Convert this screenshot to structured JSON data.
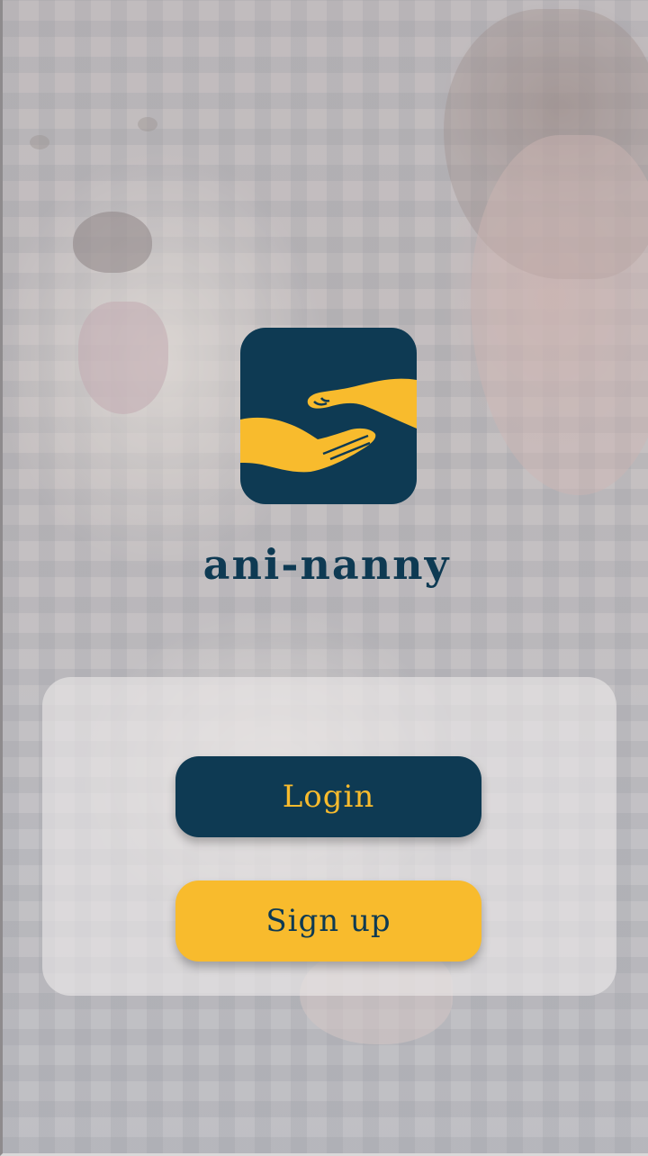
{
  "app": {
    "name": "ani-nanny",
    "logo_icon": "hand-and-paw-icon"
  },
  "colors": {
    "brand_navy": "#0e3a53",
    "brand_yellow": "#f8bb2d"
  },
  "actions": {
    "login_label": "Login",
    "signup_label": "Sign up"
  }
}
